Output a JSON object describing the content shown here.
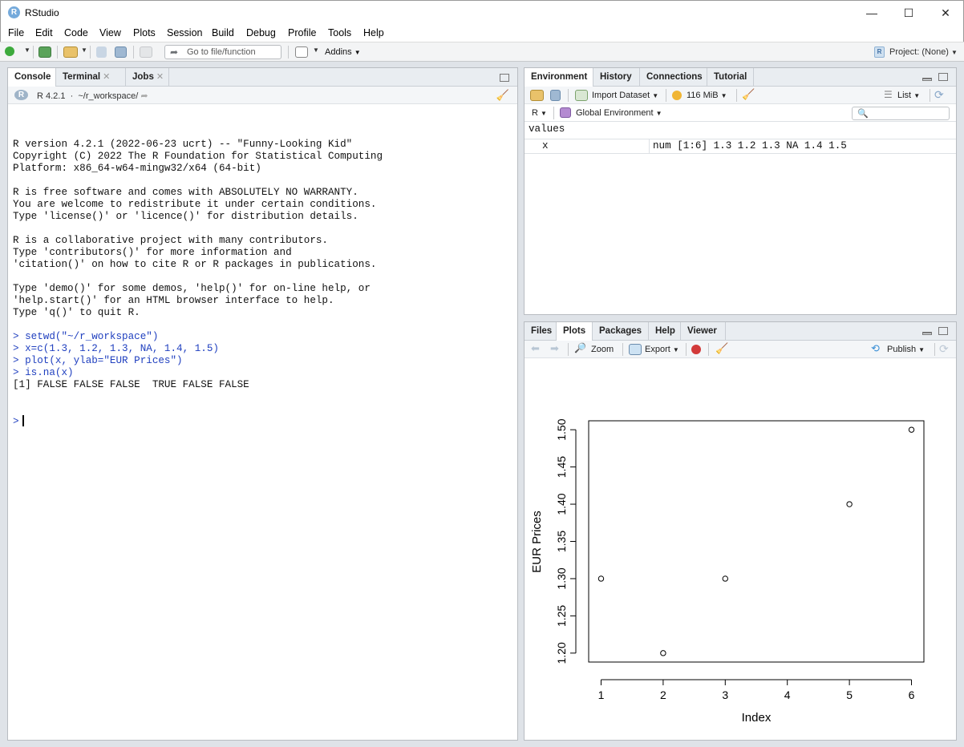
{
  "window": {
    "title": "RStudio",
    "app_icon_letter": "R",
    "minimize_glyph": "—",
    "maximize_glyph": "☐",
    "close_glyph": "✕"
  },
  "menu": [
    "File",
    "Edit",
    "Code",
    "View",
    "Plots",
    "Session",
    "Build",
    "Debug",
    "Profile",
    "Tools",
    "Help"
  ],
  "toolbar": {
    "goto_placeholder": "Go to file/function",
    "addins_label": "Addins",
    "project_label": "Project: (None)",
    "project_icon_letter": "R"
  },
  "console_pane": {
    "tabs": [
      {
        "label": "Console",
        "closable": false
      },
      {
        "label": "Terminal",
        "closable": true
      },
      {
        "label": "Jobs",
        "closable": true
      }
    ],
    "r_version_badge": "R 4.2.1",
    "working_dir": "~/r_workspace/",
    "lines": [
      {
        "text": "R version 4.2.1 (2022-06-23 ucrt) -- \"Funny-Looking Kid\"",
        "kind": "out"
      },
      {
        "text": "Copyright (C) 2022 The R Foundation for Statistical Computing",
        "kind": "out"
      },
      {
        "text": "Platform: x86_64-w64-mingw32/x64 (64-bit)",
        "kind": "out"
      },
      {
        "text": "",
        "kind": "gap"
      },
      {
        "text": "R is free software and comes with ABSOLUTELY NO WARRANTY.",
        "kind": "out"
      },
      {
        "text": "You are welcome to redistribute it under certain conditions.",
        "kind": "out"
      },
      {
        "text": "Type 'license()' or 'licence()' for distribution details.",
        "kind": "out"
      },
      {
        "text": "",
        "kind": "gap"
      },
      {
        "text": "R is a collaborative project with many contributors.",
        "kind": "out"
      },
      {
        "text": "Type 'contributors()' for more information and",
        "kind": "out"
      },
      {
        "text": "'citation()' on how to cite R or R packages in publications.",
        "kind": "out"
      },
      {
        "text": "",
        "kind": "gap"
      },
      {
        "text": "Type 'demo()' for some demos, 'help()' for on-line help, or",
        "kind": "out"
      },
      {
        "text": "'help.start()' for an HTML browser interface to help.",
        "kind": "out"
      },
      {
        "text": "Type 'q()' to quit R.",
        "kind": "out"
      },
      {
        "text": "",
        "kind": "gap"
      },
      {
        "text": "> setwd(\"~/r_workspace\")",
        "kind": "cmd"
      },
      {
        "text": "> x=c(1.3, 1.2, 1.3, NA, 1.4, 1.5)",
        "kind": "cmd"
      },
      {
        "text": "> plot(x, ylab=\"EUR Prices\")",
        "kind": "cmd"
      },
      {
        "text": "> is.na(x)",
        "kind": "cmd"
      },
      {
        "text": "[1] FALSE FALSE FALSE  TRUE FALSE FALSE",
        "kind": "out"
      }
    ],
    "prompt": ">"
  },
  "env_pane": {
    "tabs": [
      "Environment",
      "History",
      "Connections",
      "Tutorial"
    ],
    "import_dataset_label": "Import Dataset",
    "memory_label": "116 MiB",
    "view_mode_label": "List",
    "language_label": "R",
    "scope_label": "Global Environment",
    "section_header": "values",
    "rows": [
      {
        "name": "x",
        "value": "num [1:6] 1.3 1.2 1.3 NA 1.4 1.5"
      }
    ]
  },
  "files_pane": {
    "tabs": [
      "Files",
      "Plots",
      "Packages",
      "Help",
      "Viewer"
    ],
    "zoom_label": "Zoom",
    "export_label": "Export",
    "publish_label": "Publish"
  },
  "chart_data": {
    "type": "scatter",
    "x": [
      1,
      2,
      3,
      4,
      5,
      6
    ],
    "y": [
      1.3,
      1.2,
      1.3,
      null,
      1.4,
      1.5
    ],
    "xlabel": "Index",
    "ylabel": "EUR Prices",
    "xticks": [
      "1",
      "2",
      "3",
      "4",
      "5",
      "6"
    ],
    "yticks": [
      "1.20",
      "1.25",
      "1.30",
      "1.35",
      "1.40",
      "1.45",
      "1.50"
    ],
    "xlim": [
      0.8,
      6.2
    ],
    "ylim": [
      1.188,
      1.512
    ],
    "grid": false,
    "marker": "open-circle"
  }
}
